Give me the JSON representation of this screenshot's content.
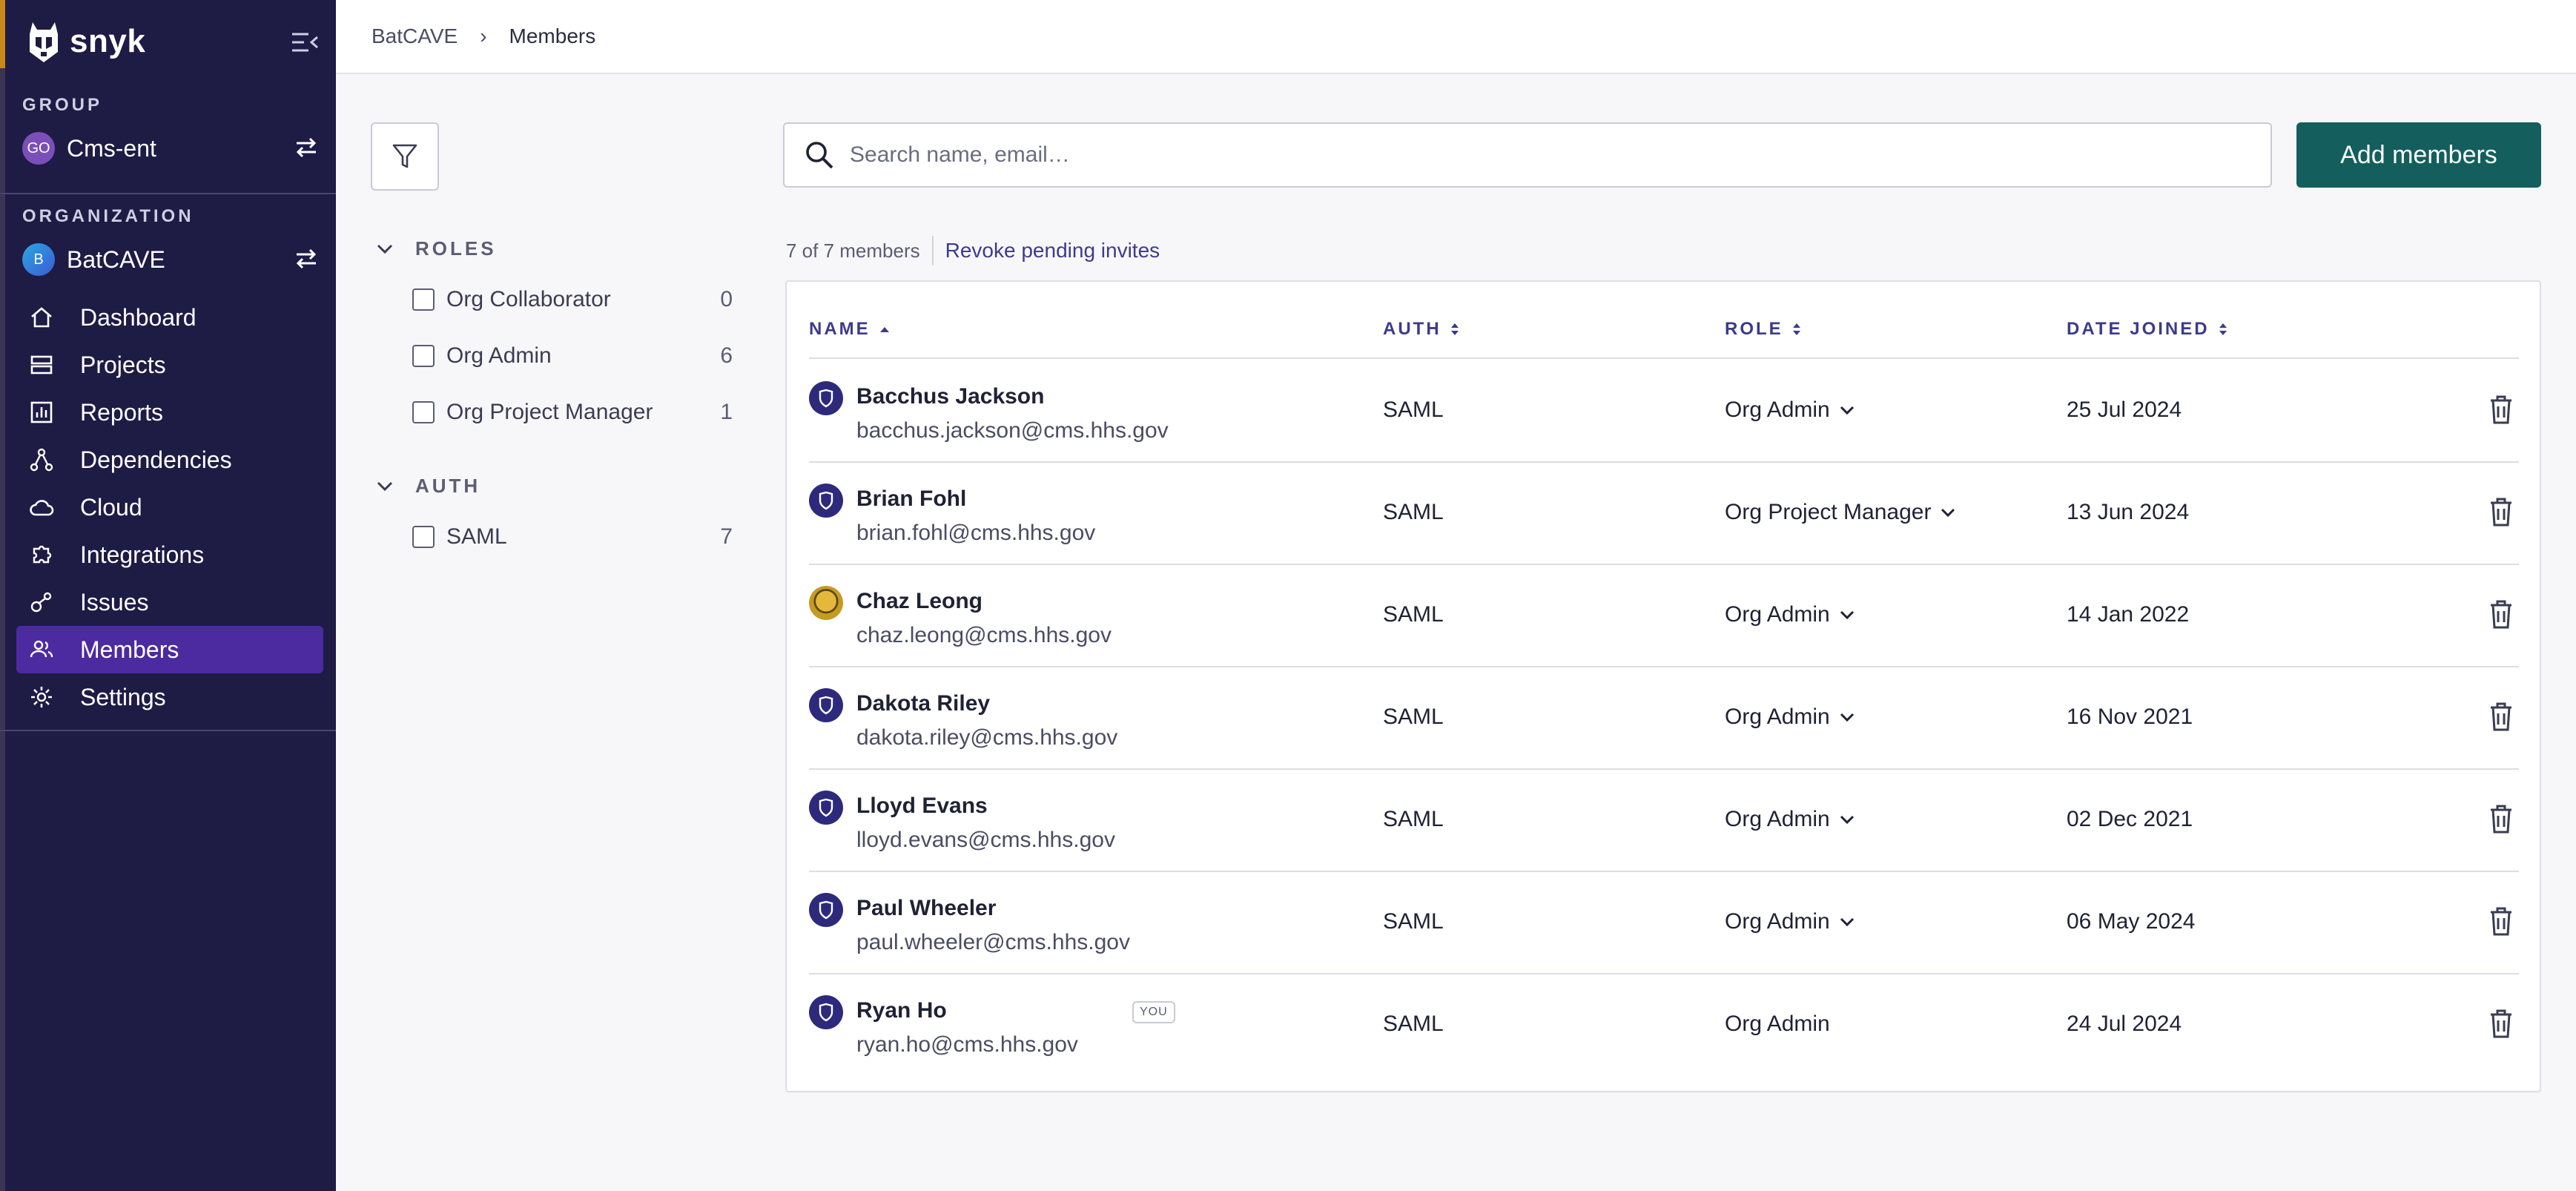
{
  "sidebar": {
    "brand": "snyk",
    "group_heading": "GROUP",
    "group_name": "Cms-ent",
    "group_initials": "GO",
    "org_heading": "ORGANIZATION",
    "org_name": "BatCAVE",
    "org_initial": "B",
    "nav": [
      {
        "label": "Dashboard",
        "icon": "home-icon"
      },
      {
        "label": "Projects",
        "icon": "projects-icon"
      },
      {
        "label": "Reports",
        "icon": "reports-icon"
      },
      {
        "label": "Dependencies",
        "icon": "dependencies-icon"
      },
      {
        "label": "Cloud",
        "icon": "cloud-icon"
      },
      {
        "label": "Integrations",
        "icon": "integrations-icon"
      },
      {
        "label": "Issues",
        "icon": "issues-icon"
      },
      {
        "label": "Members",
        "icon": "members-icon",
        "active": true
      },
      {
        "label": "Settings",
        "icon": "settings-icon"
      }
    ]
  },
  "breadcrumb": {
    "org": "BatCAVE",
    "current": "Members"
  },
  "filters": {
    "roles_heading": "ROLES",
    "roles": [
      {
        "label": "Org Collaborator",
        "count": "0"
      },
      {
        "label": "Org Admin",
        "count": "6"
      },
      {
        "label": "Org Project Manager",
        "count": "1"
      }
    ],
    "auth_heading": "AUTH",
    "auth": [
      {
        "label": "SAML",
        "count": "7"
      }
    ]
  },
  "search": {
    "placeholder": "Search name, email…",
    "value": ""
  },
  "add_button": "Add members",
  "summary": {
    "count": "7 of 7 members",
    "revoke": "Revoke pending invites"
  },
  "table": {
    "columns": {
      "name": "NAME",
      "auth": "AUTH",
      "role": "ROLE",
      "joined": "DATE JOINED"
    },
    "rows": [
      {
        "name": "Bacchus Jackson",
        "email": "bacchus.jackson@cms.hhs.gov",
        "auth": "SAML",
        "role": "Org Admin",
        "joined": "25 Jul 2024"
      },
      {
        "name": "Brian Fohl",
        "email": "brian.fohl@cms.hhs.gov",
        "auth": "SAML",
        "role": "Org Project Manager",
        "joined": "13 Jun 2024"
      },
      {
        "name": "Chaz Leong",
        "email": "chaz.leong@cms.hhs.gov",
        "auth": "SAML",
        "role": "Org Admin",
        "joined": "14 Jan 2022"
      },
      {
        "name": "Dakota Riley",
        "email": "dakota.riley@cms.hhs.gov",
        "auth": "SAML",
        "role": "Org Admin",
        "joined": "16 Nov 2021"
      },
      {
        "name": "Lloyd Evans",
        "email": "lloyd.evans@cms.hhs.gov",
        "auth": "SAML",
        "role": "Org Admin",
        "joined": "02 Dec 2021"
      },
      {
        "name": "Paul Wheeler",
        "email": "paul.wheeler@cms.hhs.gov",
        "auth": "SAML",
        "role": "Org Admin",
        "joined": "06 May 2024"
      },
      {
        "name": "Ryan Ho",
        "email": "ryan.ho@cms.hhs.gov",
        "auth": "SAML",
        "role": "Org Admin",
        "joined": "24 Jul 2024",
        "you_badge": "YOU"
      }
    ]
  },
  "colors": {
    "sidebar_bg": "#1e1b45",
    "active_nav": "#4c2aa0",
    "primary_button": "#145e5e",
    "link": "#3d3a8c"
  }
}
